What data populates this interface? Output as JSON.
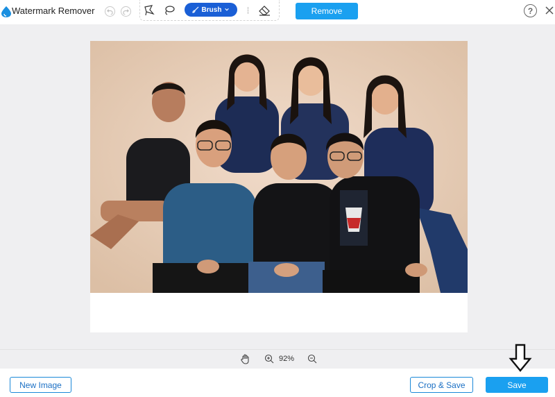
{
  "app": {
    "title": "Watermark Remover",
    "logo_icon": "droplet-logo-icon"
  },
  "toolbar": {
    "undo_icon": "undo-icon",
    "redo_icon": "redo-icon",
    "polygonal_lasso_icon": "polygonal-lasso-icon",
    "lasso_icon": "lasso-icon",
    "brush_label": "Brush",
    "eraser_icon": "eraser-icon",
    "remove_label": "Remove",
    "help_label": "?",
    "close_icon": "close-icon"
  },
  "zoom": {
    "hand_icon": "hand-icon",
    "zoom_in_icon": "zoom-in-icon",
    "level": "92%",
    "zoom_out_icon": "zoom-out-icon"
  },
  "footer": {
    "new_image_label": "New Image",
    "crop_save_label": "Crop & Save",
    "save_label": "Save"
  },
  "annotation": {
    "icon": "down-arrow-icon"
  },
  "colors": {
    "accent": "#1aa0f0",
    "brush_active": "#1a5fd6",
    "canvas_bg": "#efeff1",
    "outline_blue": "#1a88d8"
  }
}
